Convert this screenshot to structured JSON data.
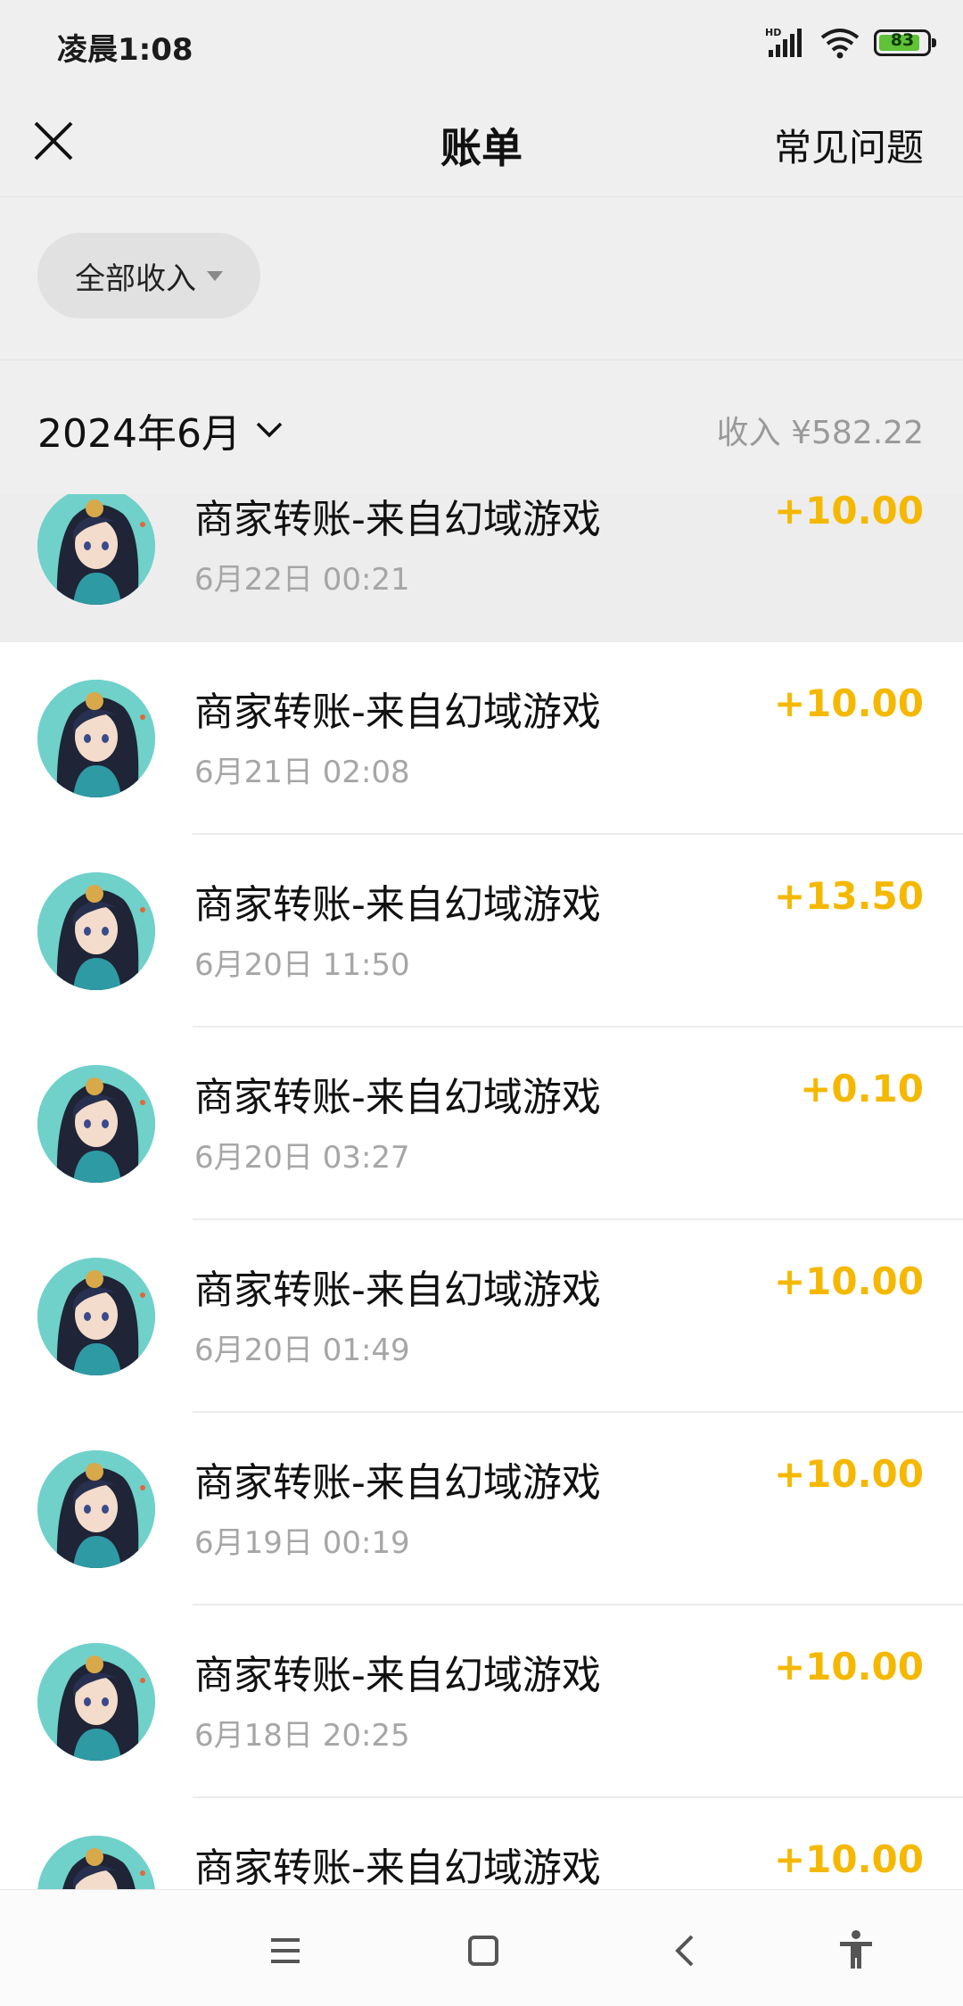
{
  "status_bar": {
    "time": "凌晨1:08",
    "battery": "83"
  },
  "header": {
    "title": "账单",
    "faq_label": "常见问题"
  },
  "filter": {
    "label": "全部收入"
  },
  "month": {
    "label": "2024年6月",
    "summary": "收入 ¥582.22"
  },
  "colors": {
    "amount": "#f5b800",
    "background": "#efefef",
    "avatar_bg": "#6fd1ca"
  },
  "transactions": [
    {
      "title": "商家转账-来自幻域游戏",
      "date": "6月22日 00:21",
      "amount": "+10.00"
    },
    {
      "title": "商家转账-来自幻域游戏",
      "date": "6月21日 02:08",
      "amount": "+10.00"
    },
    {
      "title": "商家转账-来自幻域游戏",
      "date": "6月20日 11:50",
      "amount": "+13.50"
    },
    {
      "title": "商家转账-来自幻域游戏",
      "date": "6月20日 03:27",
      "amount": "+0.10"
    },
    {
      "title": "商家转账-来自幻域游戏",
      "date": "6月20日 01:49",
      "amount": "+10.00"
    },
    {
      "title": "商家转账-来自幻域游戏",
      "date": "6月19日 00:19",
      "amount": "+10.00"
    },
    {
      "title": "商家转账-来自幻域游戏",
      "date": "6月18日 20:25",
      "amount": "+10.00"
    },
    {
      "title": "商家转账-来自幻域游戏",
      "date": "",
      "amount": "+10.00"
    }
  ],
  "nav": {
    "icons": [
      "menu-icon",
      "home-icon",
      "back-icon",
      "accessibility-icon"
    ]
  }
}
